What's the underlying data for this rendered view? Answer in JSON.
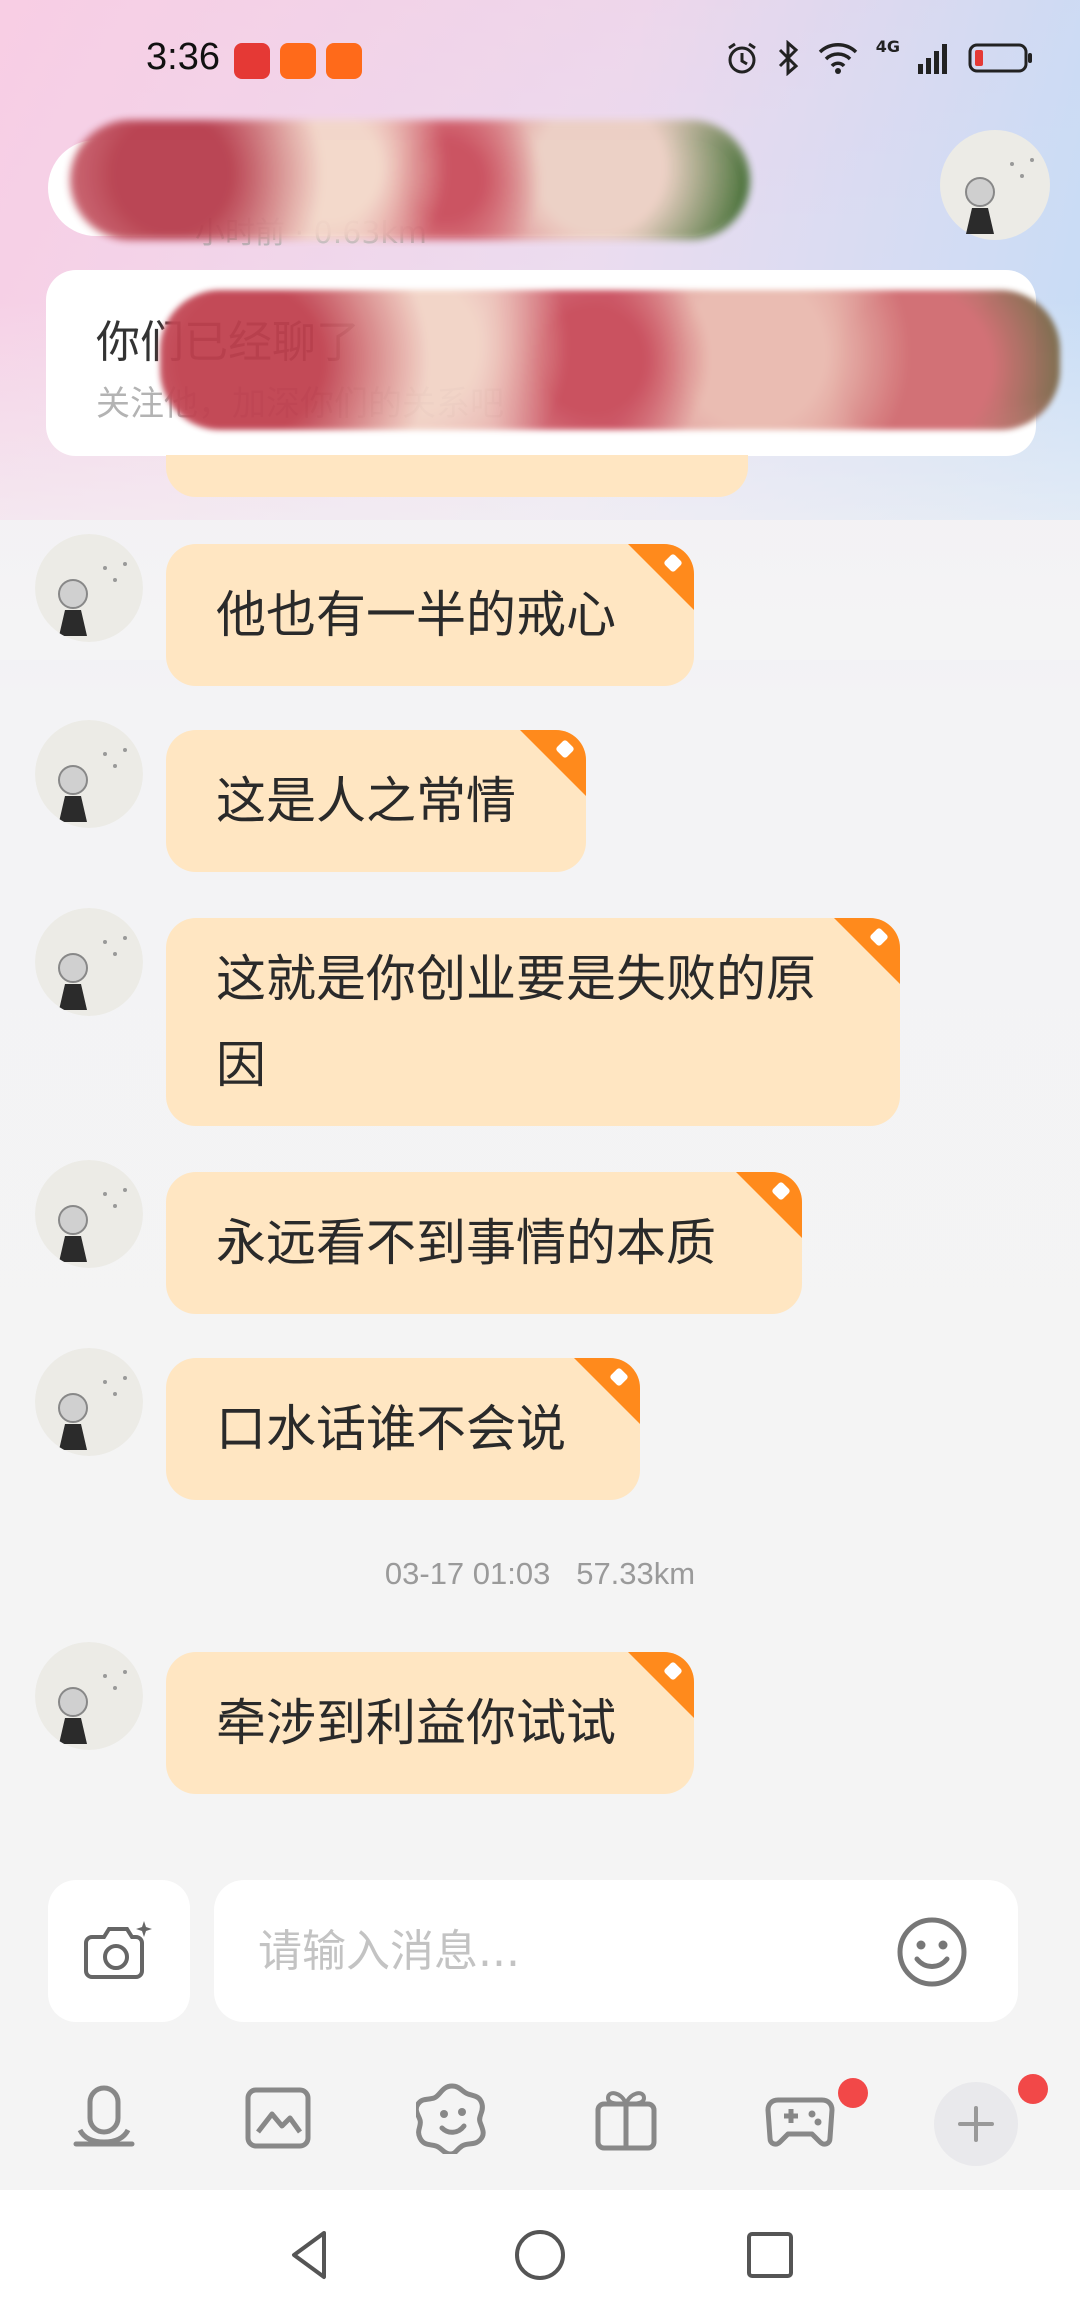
{
  "status_bar": {
    "time": "3:36",
    "app_badges": [
      {
        "name": "huawei-app-icon",
        "color": "#e53935"
      },
      {
        "name": "taobao-flash-icon",
        "color": "#ff5a1f"
      },
      {
        "name": "taobao-flash-icon",
        "color": "#ff5a1f"
      }
    ],
    "network": "4G",
    "battery_color": "#e53935"
  },
  "header": {
    "contact_sub": "小时前 · 0.63km",
    "follow_card": {
      "title": "你们已经聊了",
      "subtitle": "关注他，加深你们的关系吧"
    }
  },
  "messages": [
    {
      "text": "他也有一半的戒心"
    },
    {
      "text": "这是人之常情"
    },
    {
      "text": "这就是你创业要是失败的原因"
    },
    {
      "text": "永远看不到事情的本质"
    },
    {
      "text": "口水话谁不会说"
    },
    {
      "timestamp": "03-17 01:03   57.33km"
    },
    {
      "text": "牵涉到利益你试试"
    }
  ],
  "input": {
    "placeholder": "请输入消息..."
  },
  "toolbar": {
    "icons": [
      "voice-icon",
      "image-icon",
      "sticker-icon",
      "gift-icon",
      "game-icon",
      "plus-icon"
    ],
    "badges": {
      "game": true,
      "plus": true
    }
  },
  "colors": {
    "bubble": "#ffe6c2",
    "corner_badge": "#ff8a1c",
    "notification_dot": "#f24848"
  }
}
